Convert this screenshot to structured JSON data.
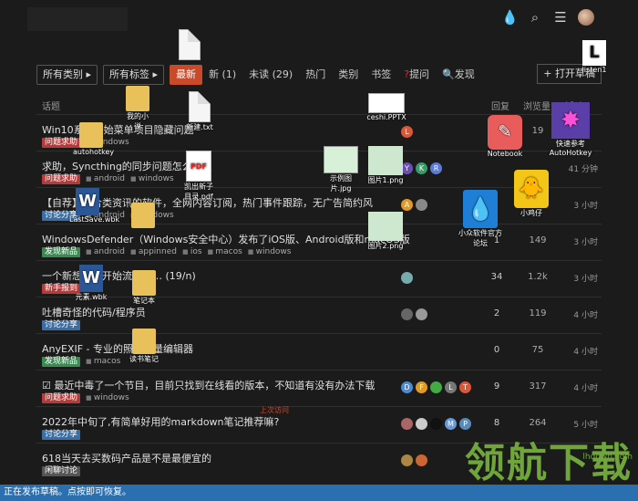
{
  "nav": {
    "category_dd": "所有类别 ▸",
    "tag_dd": "所有标签 ▸",
    "tabs": [
      "最新",
      "新 (1)",
      "未读 (29)",
      "热门",
      "类别",
      "书签",
      "提问",
      "发现"
    ],
    "ask_mark": "?",
    "open_btn": "+ 打开草稿"
  },
  "thead": {
    "topic": "话题",
    "replies": "回复",
    "views": "浏览量",
    "activity": "活动"
  },
  "topics": [
    {
      "title": "Win10系统开始菜单项目隐藏问题",
      "tags": [
        {
          "t": "问题求助",
          "c": "red"
        },
        {
          "t": "windows",
          "c": ""
        }
      ],
      "avatars": [
        {
          "l": "L",
          "c": "#d9583b"
        }
      ],
      "replies": "",
      "views": "19",
      "activity": ""
    },
    {
      "title": "求助，Syncthing的同步问题怎么设置",
      "tags": [
        {
          "t": "问题求助",
          "c": "red"
        },
        {
          "t": "android",
          "c": ""
        },
        {
          "t": "windows",
          "c": ""
        }
      ],
      "avatars": [
        {
          "l": "Y",
          "c": "#6b4fb0"
        },
        {
          "l": "K",
          "c": "#3a9a6a"
        },
        {
          "l": "R",
          "c": "#5b7bd5"
        }
      ],
      "replies": "",
      "views": "",
      "activity": "41 分钟"
    },
    {
      "title": "【自荐】综合类资讯的软件，全网内容订阅，热门事件跟踪，无广告简约风",
      "tags": [
        {
          "t": "讨论分享",
          "c": ""
        },
        {
          "t": "android",
          "c": ""
        },
        {
          "t": "windows",
          "c": ""
        }
      ],
      "avatars": [
        {
          "l": "A",
          "c": "#e09a2a"
        },
        {
          "l": "",
          "c": "#888"
        }
      ],
      "replies": "",
      "views": "",
      "activity": "3 小时"
    },
    {
      "title": "WindowsDefender（Windows安全中心）发布了iOS版、Android版和macOS版",
      "tags": [
        {
          "t": "发现新品",
          "c": "green"
        },
        {
          "t": "android",
          "c": ""
        },
        {
          "t": "appinned",
          "c": ""
        },
        {
          "t": "ios",
          "c": ""
        },
        {
          "t": "macos",
          "c": ""
        },
        {
          "t": "windows",
          "c": ""
        }
      ],
      "avatars": [],
      "replies": "1",
      "views": "149",
      "activity": "3 小时"
    },
    {
      "title": "一个新想法，开始流水账… (19/n)",
      "tags": [
        {
          "t": "新手报到",
          "c": "red"
        }
      ],
      "avatars": [
        {
          "l": "",
          "c": "#7aa"
        }
      ],
      "replies": "34",
      "views": "1.2k",
      "activity": "3 小时"
    },
    {
      "title": "吐槽奇怪的代码/程序员",
      "tags": [
        {
          "t": "讨论分享",
          "c": ""
        }
      ],
      "avatars": [
        {
          "l": "",
          "c": "#666"
        },
        {
          "l": "",
          "c": "#999"
        }
      ],
      "replies": "2",
      "views": "119",
      "activity": "4 小时"
    },
    {
      "title": "AnyEXIF - 专业的照片批量编辑器",
      "tags": [
        {
          "t": "发现新品",
          "c": "green"
        },
        {
          "t": "macos",
          "c": ""
        }
      ],
      "avatars": [],
      "replies": "0",
      "views": "75",
      "activity": "4 小时"
    },
    {
      "title": "☑ 最近中毒了一个节目，目前只找到在线看的版本，不知道有没有办法下载",
      "tags": [
        {
          "t": "问题求助",
          "c": "red"
        },
        {
          "t": "windows",
          "c": ""
        }
      ],
      "avatars": [
        {
          "l": "D",
          "c": "#4d8ad6"
        },
        {
          "l": "F",
          "c": "#e09a2a"
        },
        {
          "l": "",
          "c": "#4a4"
        },
        {
          "l": "L",
          "c": "#777"
        },
        {
          "l": "T",
          "c": "#d9583b"
        }
      ],
      "replies": "9",
      "views": "317",
      "activity": "4 小时"
    },
    {
      "title": "2022年中旬了,有简单好用的markdown笔记推荐嘛?",
      "tags": [
        {
          "t": "讨论分享",
          "c": ""
        }
      ],
      "avatars": [
        {
          "l": "",
          "c": "#a66"
        },
        {
          "l": "",
          "c": "#ccc"
        },
        {
          "l": "",
          "c": "#111"
        },
        {
          "l": "M",
          "c": "#6a9ad6"
        },
        {
          "l": "P",
          "c": "#5a8ab6"
        }
      ],
      "replies": "8",
      "views": "264",
      "activity": "5 小时"
    },
    {
      "title": "618当天去买数码产品是不是最便宜的",
      "tags": [
        {
          "t": "闲聊讨论",
          "c": "gray"
        }
      ],
      "avatars": [
        {
          "l": "",
          "c": "#a84"
        },
        {
          "l": "",
          "c": "#c63"
        }
      ],
      "replies": "",
      "views": "",
      "activity": ""
    }
  ],
  "last_visit": "上次访问",
  "desktop": {
    "ppt": "ceshi.PPTX",
    "listen": "listen1",
    "notebook": "Notebook",
    "quick": "快速参考",
    "autohotkey": "AutoHotkey",
    "autohotkey2": "autohotkey",
    "ahk_prefix": "AHK",
    "newtxt": "新建.txt",
    "pdf_label": "PDF",
    "pdf": "凯出新子目录.pdf",
    "img": "示例图片.jpg",
    "png1": "图片1.png",
    "png2": "图片2.png",
    "lastsave": "LastSave.wbk",
    "wbk": "元素.wbk",
    "folder_a": "我的小说",
    "folder_b": "笔记本",
    "folder_c": "读书笔记",
    "small": "小众软件官方论坛",
    "chick": "小鸡仔",
    "wmark": "领航下载",
    "wmark_site": "lhdown.com"
  },
  "status": "正在发布草稿。点按即可恢复。"
}
